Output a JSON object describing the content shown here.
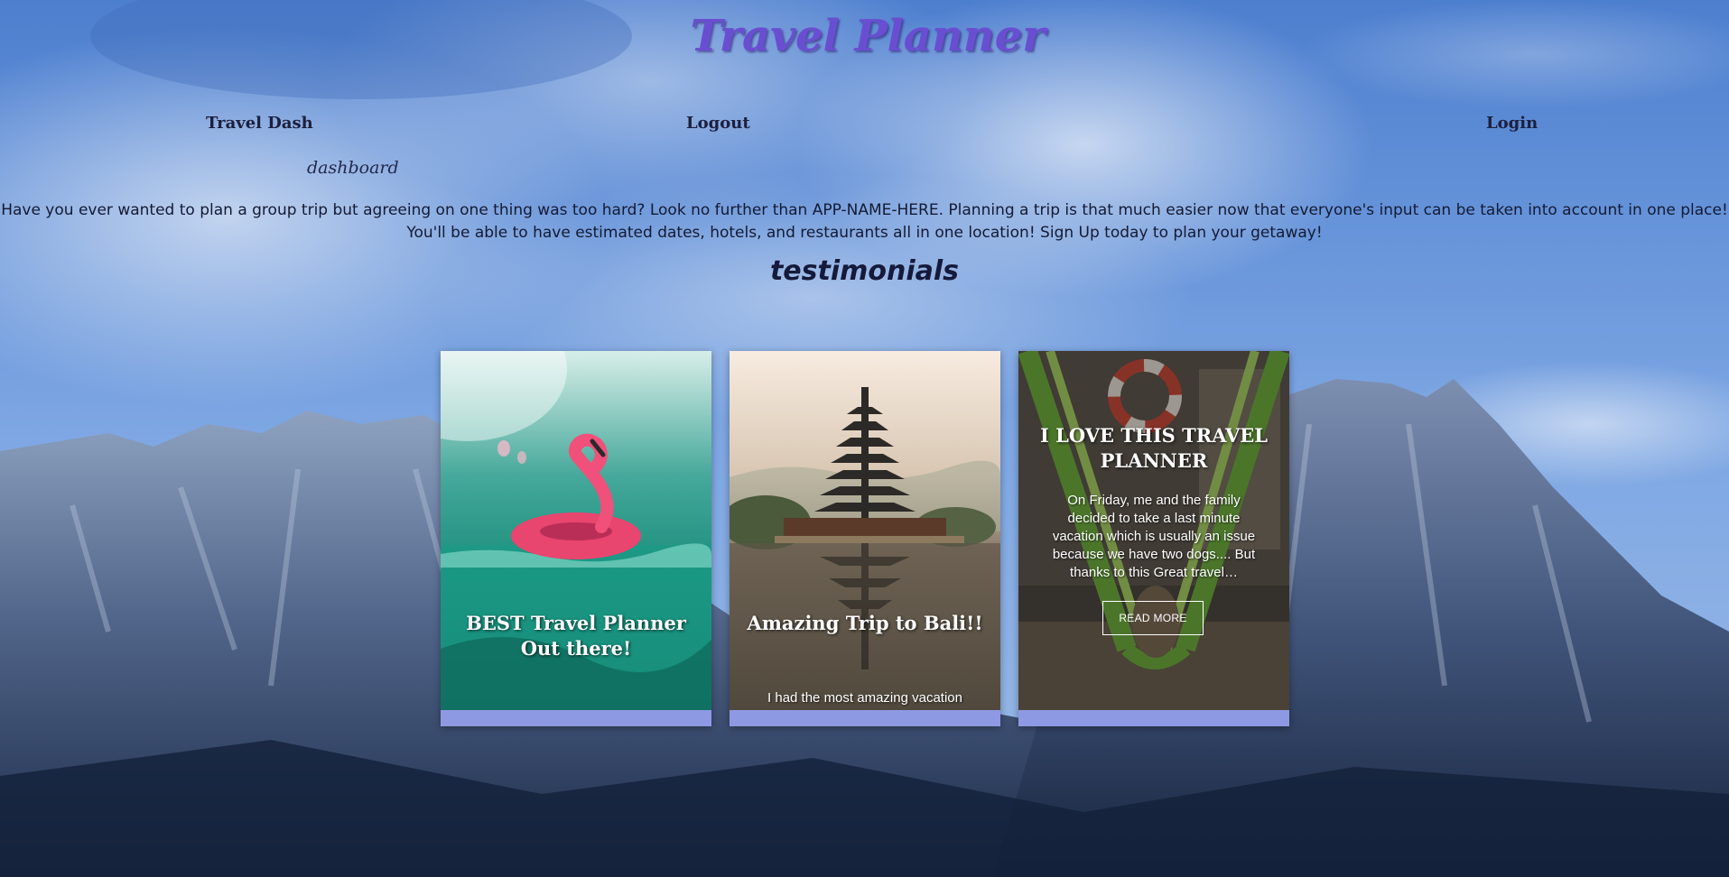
{
  "header": {
    "title": "Travel Planner"
  },
  "nav": {
    "travel_dash": "Travel Dash",
    "logout": "Logout",
    "login": "Login",
    "dashboard": "dashboard"
  },
  "intro": {
    "text": "Have you ever wanted to plan a group trip but agreeing on one thing was too hard? Look no further than APP-NAME-HERE. Planning a trip is that much easier now that everyone's input can be taken into account in one place! You'll be able to have estimated dates, hotels, and restaurants all in one location! Sign Up today to plan your getaway!"
  },
  "testimonials": {
    "heading": "testimonials",
    "cards": [
      {
        "title": "BEST Travel Planner Out there!",
        "image": "flamingo-float-icon"
      },
      {
        "title": "Amazing Trip to Bali!!",
        "snippet": "I had the most amazing vacation",
        "image": "pagoda-lake-icon"
      },
      {
        "title": "I LOVE THIS TRAVEL PLANNER",
        "snippet": "On Friday, me and the family decided to take a last minute vacation which is usually an issue because we have two dogs.... But thanks to this Great travel…",
        "button": "READ MORE",
        "image": "hammock-dog-icon"
      }
    ]
  },
  "colors": {
    "title": "#6a4ed1",
    "card_footer": "#8e99e3",
    "nav_text": "#1c1f3d"
  }
}
